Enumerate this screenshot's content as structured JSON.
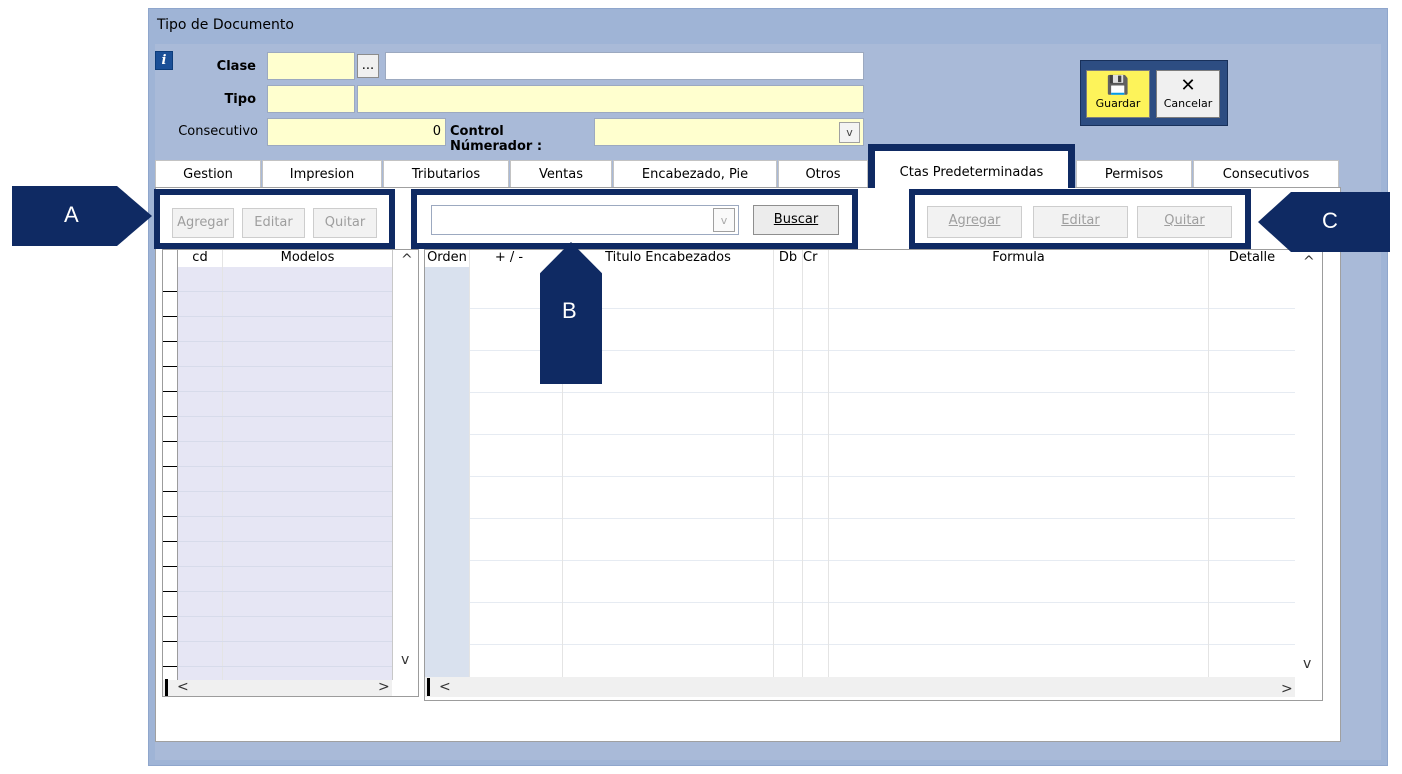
{
  "window": {
    "title": "Tipo de Documento"
  },
  "form": {
    "info_icon": "i",
    "clase_label": "Clase",
    "clase_browse": "...",
    "tipo_label": "Tipo",
    "consecutivo_label": "Consecutivo",
    "consecutivo_value": "0",
    "control_label": "Control Númerador :"
  },
  "actions": {
    "save_label": "Guardar",
    "cancel_label": "Cancelar"
  },
  "tabs": [
    "Gestion",
    "Impresion",
    "Tributarios",
    "Ventas",
    "Encabezado, Pie",
    "Otros",
    "Ctas Predeterminadas",
    "Permisos",
    "Consecutivos"
  ],
  "left_toolbar": {
    "add": "Agregar",
    "edit": "Editar",
    "remove": "Quitar"
  },
  "search": {
    "button": "Buscar"
  },
  "right_toolbar": {
    "add": "Agregar",
    "edit": "Editar",
    "remove": "Quitar"
  },
  "left_grid": {
    "columns": [
      "cd",
      "Modelos"
    ]
  },
  "right_grid": {
    "columns": [
      "Orden",
      "+ / -",
      "Titulo Encabezados",
      "Db",
      "Cr",
      "Formula",
      "Detalle"
    ]
  },
  "callouts": {
    "a": "A",
    "b": "B",
    "c": "C"
  },
  "scroll": {
    "up": "^",
    "down": "v",
    "left": "<",
    "right": ">",
    "combo": "v"
  }
}
